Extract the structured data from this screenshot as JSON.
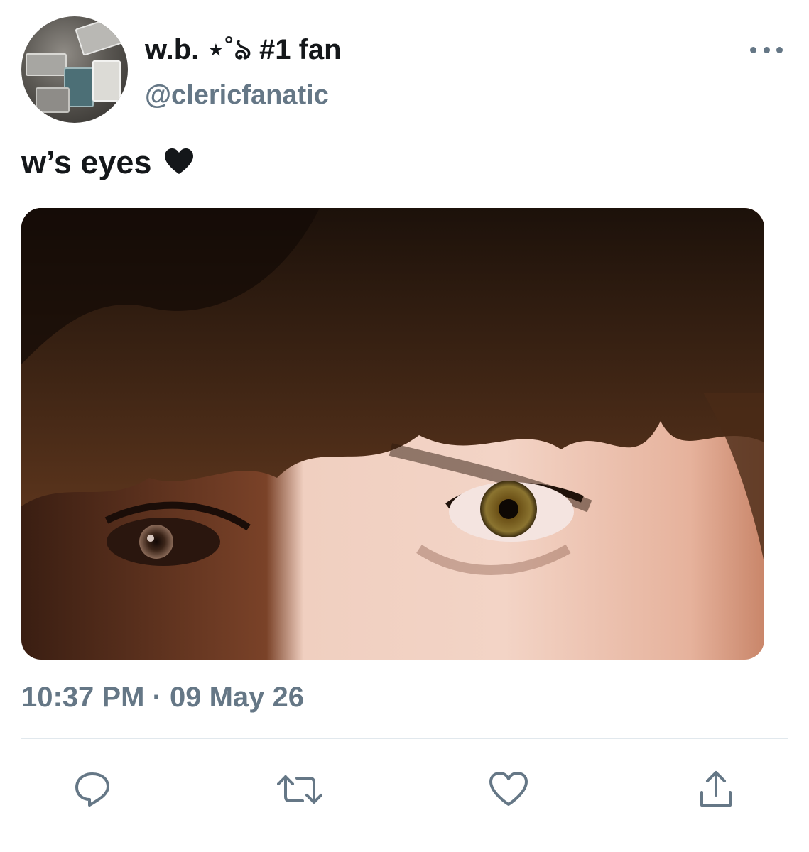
{
  "tweet": {
    "display_name": "w.b. ⋆˚ঌ #1 fan",
    "handle": "@clericfanatic",
    "text": "w’s eyes",
    "timestamp": "10:37 PM · 09 May 26"
  },
  "icons": {
    "more": "more-horizontal-icon",
    "reply": "reply-icon",
    "retweet": "retweet-icon",
    "like": "heart-icon",
    "share": "share-icon"
  },
  "colors": {
    "text": "#14171a",
    "secondary": "#657786",
    "divider": "#e1e8ed"
  }
}
